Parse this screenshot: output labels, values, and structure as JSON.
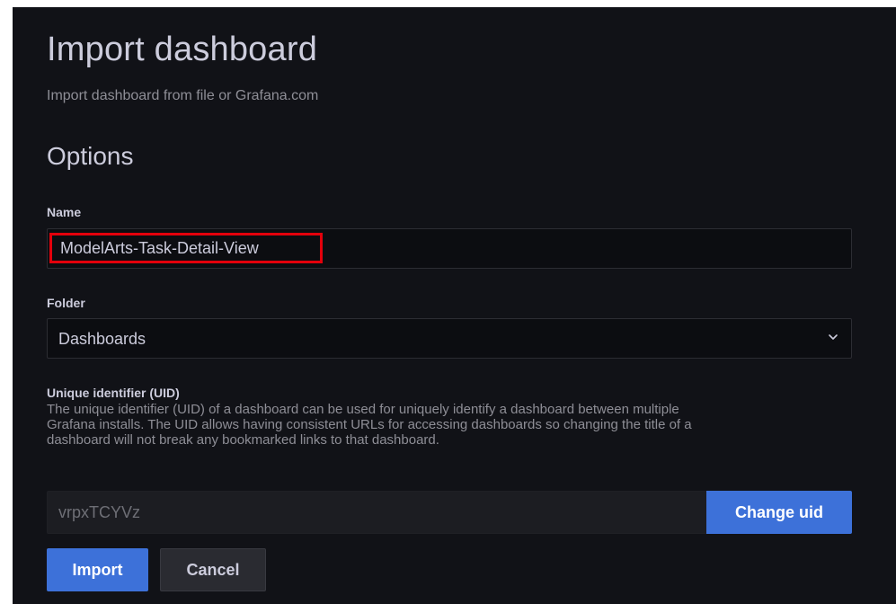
{
  "header": {
    "title": "Import dashboard",
    "subtitle": "Import dashboard from file or Grafana.com"
  },
  "options": {
    "section_title": "Options",
    "name": {
      "label": "Name",
      "value": "ModelArts-Task-Detail-View"
    },
    "folder": {
      "label": "Folder",
      "selected": "Dashboards",
      "icon": "chevron-down-icon"
    },
    "uid": {
      "label": "Unique identifier (UID)",
      "description": "The unique identifier (UID) of a dashboard can be used for uniquely identify a dashboard between multiple Grafana installs. The UID allows having consistent URLs for accessing dashboards so changing the title of a dashboard will not break any bookmarked links to that dashboard.",
      "value": "vrpxTCYVz",
      "change_label": "Change uid"
    }
  },
  "actions": {
    "import_label": "Import",
    "cancel_label": "Cancel"
  },
  "colors": {
    "background": "#111217",
    "primary": "#3d71d9",
    "highlight": "#e3000b"
  }
}
